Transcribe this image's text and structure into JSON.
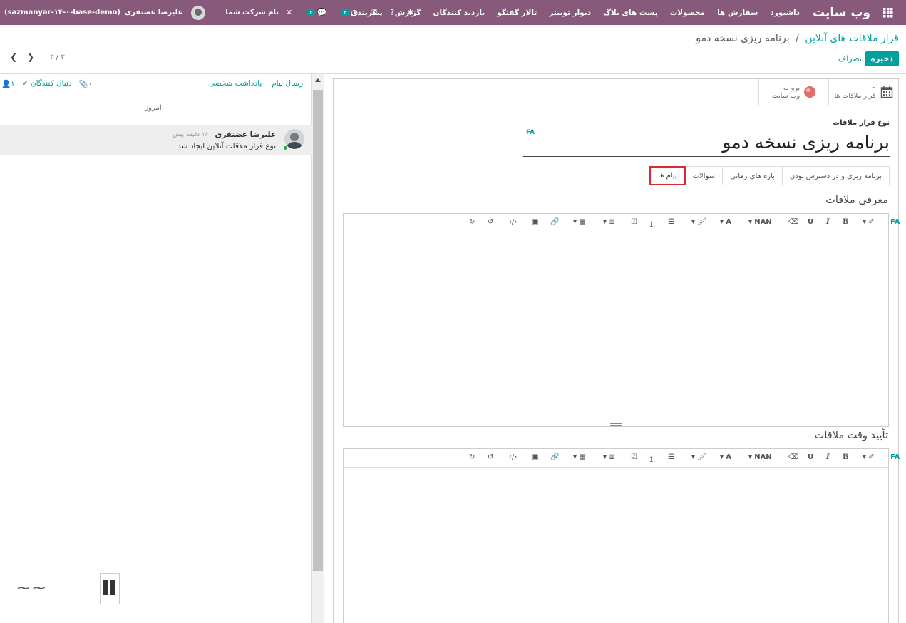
{
  "navbar": {
    "brand": "وب سایت",
    "menu": [
      "داشبورد",
      "سفارش ها",
      "محصولات",
      "پست های بلاگ",
      "دیوار توییتر",
      "تالار گفتگو",
      "بازدید کنندگان",
      "گزارش",
      "پیکربندی"
    ],
    "db_name": "(sazmanyar-۱۴-۰-base-demo)",
    "user_name": "علیرضا غضنفری",
    "company": "نام شرکت شما",
    "activity_count": "۴",
    "message_count": "۳"
  },
  "breadcrumb": {
    "parent": "قرار ملاقات های آنلاین",
    "separator": "/",
    "current": "برنامه ریزی نسخه دمو"
  },
  "buttons": {
    "save": "ذخیره",
    "discard": "انصراف"
  },
  "pager": {
    "value": "۳ / ۳"
  },
  "chatter": {
    "send_message": "ارسال پیام",
    "log_note": "یادداشت شخصی",
    "attachments": "۰",
    "follow": "دنبال کنندگان",
    "followers_count": "۱",
    "today": "امروز",
    "message": {
      "author": "علیرضا غضنفری",
      "time": "۱۶ دقیقه پیش",
      "body": "نوع قرار ملاقات آنلاین ایجاد شد"
    }
  },
  "smart_buttons": {
    "meetings_count": "۰",
    "meetings_label": "قرار ملاقات ها",
    "website_line1": "برو به",
    "website_line2": "وب سایت"
  },
  "form": {
    "type_label": "نوع قرار ملاقات",
    "title": "برنامه ریزی نسخه دمو",
    "lang": "FA",
    "tabs": [
      "برنامه ریزی و در دسترس بودن",
      "بازه های زمانی",
      "سوالات",
      "پیام ها"
    ],
    "active_tab": "پیام ها",
    "section1": "معرفی ملاقات",
    "section2": "تأیید وقت ملاقات",
    "font_size_label": "NAN"
  },
  "colors": {
    "navbar": "#875a7b",
    "accent": "#00a09d",
    "active_tab_border": "#e0262e"
  }
}
